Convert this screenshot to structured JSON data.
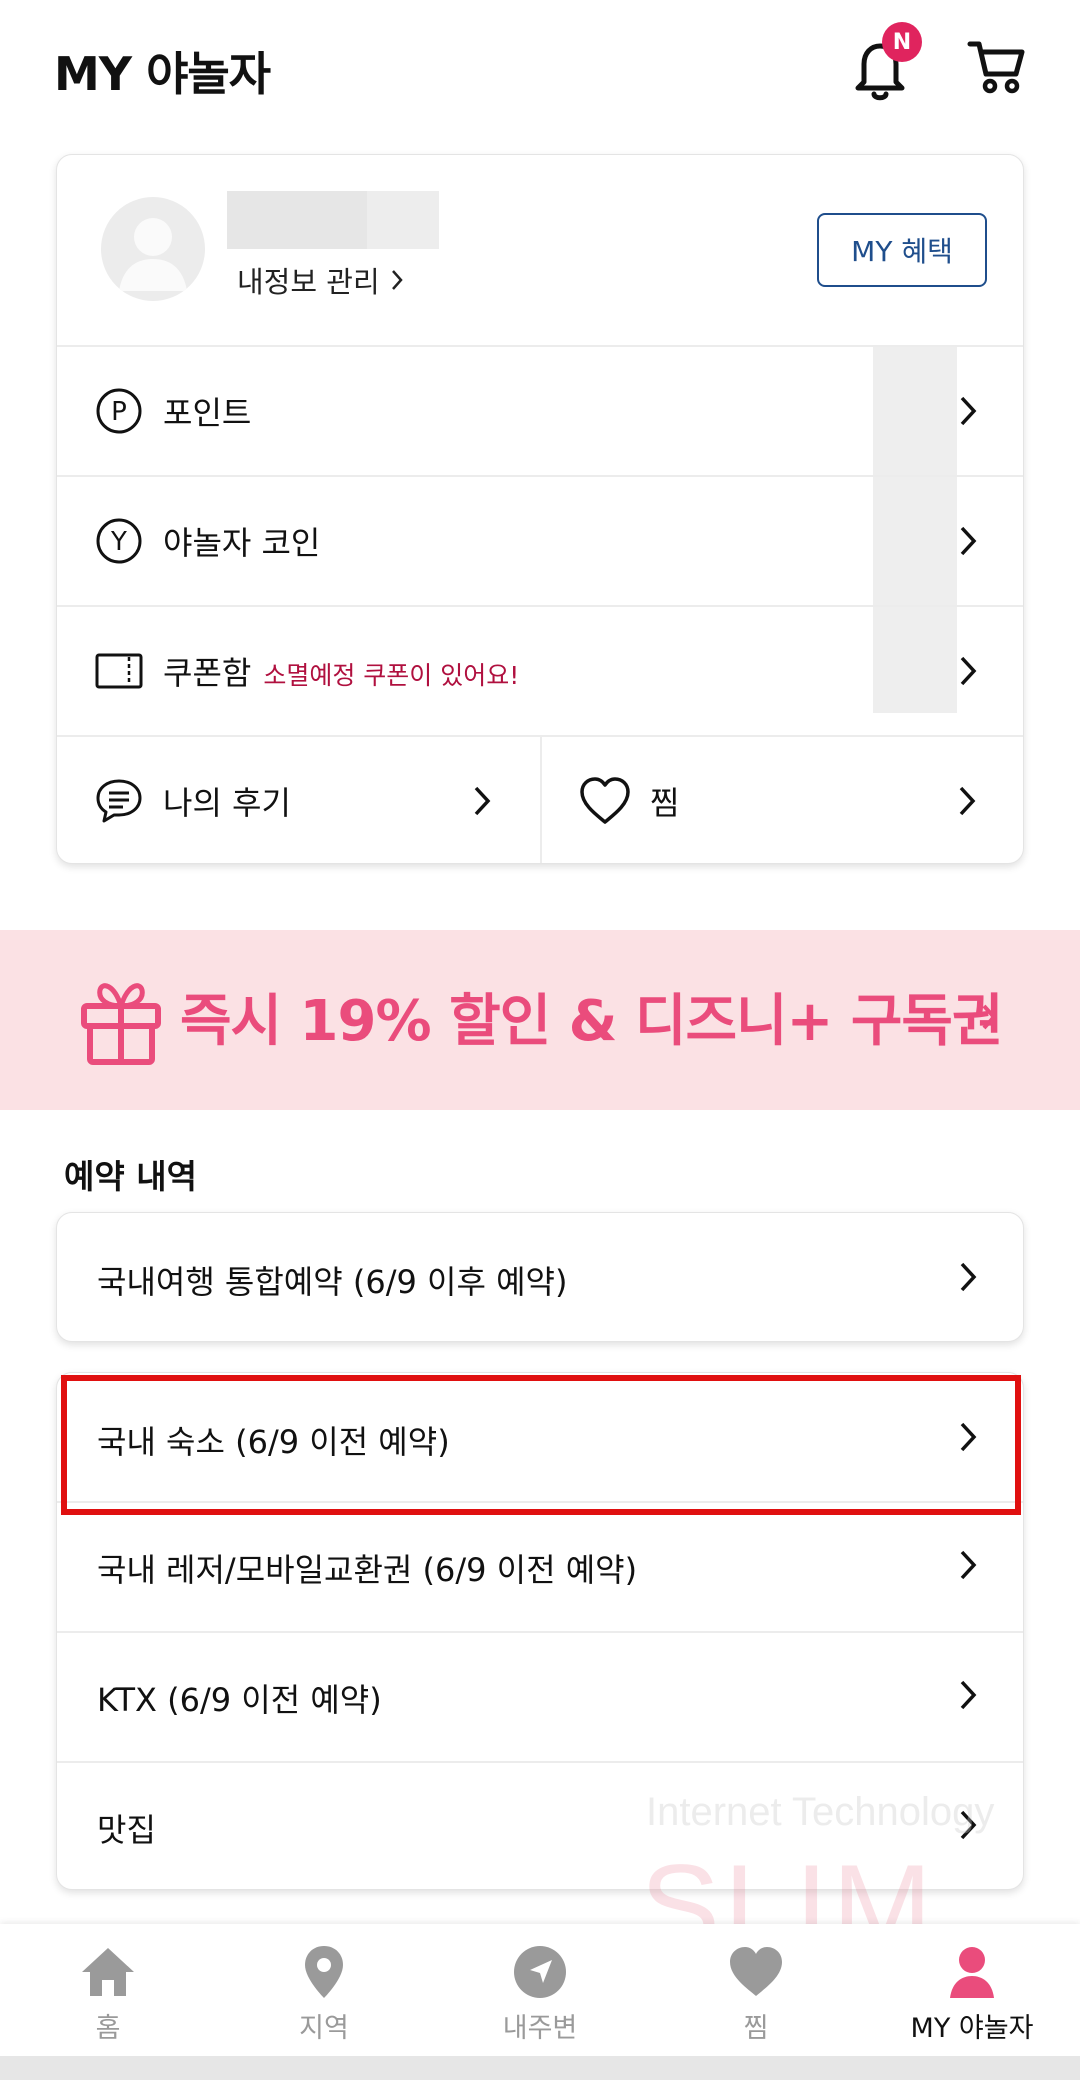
{
  "header": {
    "title": "MY 야놀자",
    "notification_badge": "N"
  },
  "profile": {
    "manage_link": "내정보 관리",
    "benefit_button": "MY 혜택"
  },
  "menu": {
    "point": "포인트",
    "coin": "야놀자 코인",
    "coupon": "쿠폰함",
    "coupon_note": "소멸예정 쿠폰이 있어요!",
    "review": "나의 후기",
    "wishlist": "찜"
  },
  "banner": {
    "text": "즉시 19% 할인 & 디즈니+ 구독권"
  },
  "reservations": {
    "section_title": "예약 내역",
    "integrated": "국내여행 통합예약 (6/9 이후 예약)",
    "items": [
      "국내 숙소 (6/9 이전 예약)",
      "국내 레저/모바일교환권 (6/9 이전 예약)",
      "KTX (6/9 이전 예약)",
      "맛집"
    ]
  },
  "bottom_nav": [
    {
      "label": "홈",
      "icon": "home-icon"
    },
    {
      "label": "지역",
      "icon": "location-pin-icon"
    },
    {
      "label": "내주변",
      "icon": "navigation-arrow-icon"
    },
    {
      "label": "찜",
      "icon": "heart-icon"
    },
    {
      "label": "MY 야놀자",
      "icon": "person-icon"
    }
  ],
  "watermark": {
    "line1": "Internet Technology",
    "line2": "SLIM"
  },
  "colors": {
    "brand_pink": "#ea4c7c",
    "banner_bg": "#fbe1e4",
    "benefit_blue": "#1f4e8c",
    "coupon_note": "#b0103f",
    "highlight_red": "#e01010"
  }
}
